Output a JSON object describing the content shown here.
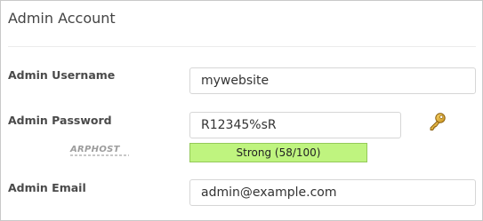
{
  "section": {
    "title": "Admin Account"
  },
  "username": {
    "label": "Admin Username",
    "value": "mywebsite"
  },
  "password": {
    "label": "Admin Password",
    "value": "R12345%sR",
    "strength_text": "Strong (58/100)",
    "strength_score": 58,
    "strength_max": 100,
    "strength_color": "#bff47f",
    "generate_icon": "key-icon"
  },
  "email": {
    "label": "Admin Email",
    "value": "admin@example.com"
  },
  "watermark": {
    "text": "ARPHOST"
  }
}
